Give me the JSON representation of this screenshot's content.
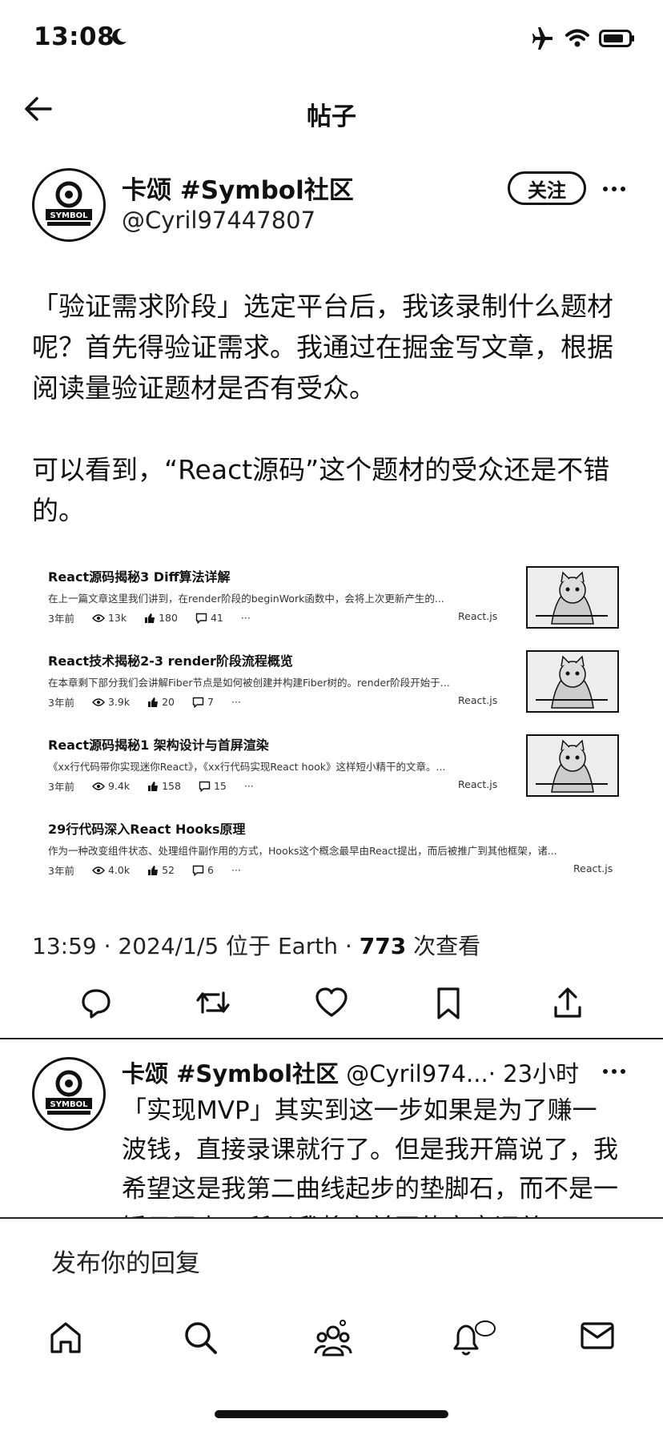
{
  "status_bar": {
    "time": "13:08"
  },
  "header": {
    "title": "帖子"
  },
  "post": {
    "author_name": "卡颂 #Symbol社区",
    "author_handle": "@Cyril97447807",
    "follow_label": "关注",
    "paragraphs": [
      "「验证需求阶段」选定平台后，我该录制什么题材呢？首先得验证需求。我通过在掘金写文章，根据阅读量验证题材是否有受众。",
      "可以看到，“React源码”这个题材的受众还是不错的。"
    ],
    "articles": [
      {
        "title": "React源码揭秘3 Diff算法详解",
        "desc": "在上一篇文章这里我们讲到，在render阶段的beginWork函数中，会将上次更新产生的...",
        "time": "3年前",
        "views": "13k",
        "likes": "180",
        "comments": "41",
        "tag": "React.js"
      },
      {
        "title": "React技术揭秘2-3 render阶段流程概览",
        "desc": "在本章剩下部分我们会讲解Fiber节点是如何被创建并构建Fiber树的。render阶段开始于...",
        "time": "3年前",
        "views": "3.9k",
        "likes": "20",
        "comments": "7",
        "tag": "React.js"
      },
      {
        "title": "React源码揭秘1 架构设计与首屏渲染",
        "desc": "《xx行代码带你实现迷你React》，《xx行代码实现React hook》这样短小精干的文章。...",
        "time": "3年前",
        "views": "9.4k",
        "likes": "158",
        "comments": "15",
        "tag": "React.js"
      },
      {
        "title": "29行代码深入React Hooks原理",
        "desc": "作为一种改变组件状态、处理组件副作用的方式，Hooks这个概念最早由React提出，而后被推广到其他框架，诸...",
        "time": "3年前",
        "views": "4.0k",
        "likes": "52",
        "comments": "6",
        "tag": "React.js"
      }
    ],
    "meta_prefix": "13:59 · 2024/1/5 位于 Earth · ",
    "meta_views": "773",
    "meta_suffix": " 次查看"
  },
  "reply": {
    "author_name": "卡颂 #Symbol社区",
    "author_handle": "@Cyril974...",
    "time": "· 23小时",
    "text": "「实现MVP」其实到这一步如果是为了赚一波钱，直接录课就行了。但是我开篇说了，我希望这是我第二曲线起步的垫脚石，而不是一锤子买卖，所以我将之前写的文章汇总"
  },
  "compose": {
    "placeholder": "发布你的回复"
  },
  "avatar_text": "SYMBOL",
  "icons": [
    "back-arrow-icon",
    "moon-icon",
    "airplane-icon",
    "wifi-icon",
    "battery-icon",
    "more-icon",
    "reply-icon",
    "repost-icon",
    "like-icon",
    "bookmark-icon",
    "share-icon",
    "home-icon",
    "search-icon",
    "communities-icon",
    "notifications-icon",
    "messages-icon"
  ]
}
